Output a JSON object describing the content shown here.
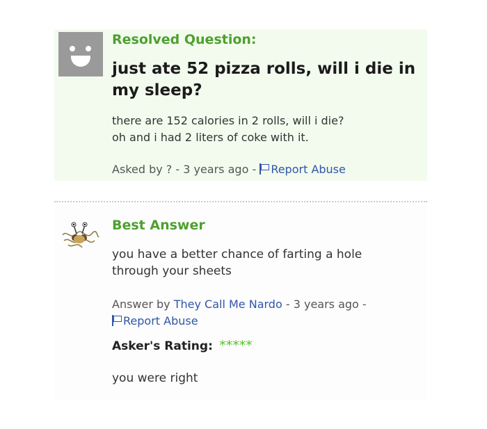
{
  "question": {
    "status_label": "Resolved Question:",
    "title": "just ate 52 pizza rolls, will i die in my sleep?",
    "body_line1": "there are 152 calories in 2 rolls, will i die?",
    "body_line2": "oh and i had 2 liters of coke with it.",
    "asked_by": "Asked by ?",
    "time": "- 3 years ago -",
    "report_label": "Report Abuse",
    "avatar_icon": "default-smiley-avatar-icon"
  },
  "answer": {
    "heading": "Best Answer",
    "body_line1": "you have a better chance of farting a hole",
    "body_line2": "through your sheets",
    "answer_by_label": "Answer by",
    "author": "They Call Me Nardo",
    "time": "- 3 years ago -",
    "report_label": "Report Abuse",
    "avatar_icon": "flying-spaghetti-monster-icon"
  },
  "rating": {
    "label": "Asker's Rating:",
    "stars": "*****",
    "value": 5,
    "max": 5,
    "comment": "you were right"
  },
  "colors": {
    "accent_green": "#4ea02f",
    "link_blue": "#2f56a8",
    "star_green": "#56c22c"
  }
}
